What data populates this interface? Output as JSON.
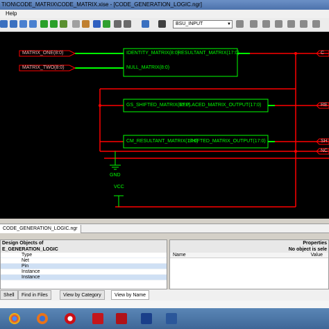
{
  "window": {
    "title": "TION\\CODE_MATRIX\\CODE_MATRIX.xise - [CODE_GENERATION_LOGIC.ngr]"
  },
  "menu": {
    "help": "Help"
  },
  "toolbar": {
    "select_value": "BSU_INPUT"
  },
  "schematic": {
    "inputs": [
      "MATRIX_ONE(8:0)",
      "MATRIX_TWO(8:0)"
    ],
    "blocks": [
      {
        "pin_left_1": "IDENTITY_MATRIX(8:0)",
        "pin_left_2": "NULL_MATRIX(8:0)",
        "pin_right": "RESULTANT_MATRIX(17:0)"
      },
      {
        "pin_left": "GS_SHIFTED_MATRIX(17:0)",
        "pin_right": "REPLACED_MATRIX_OUTPUT(17:0)"
      },
      {
        "pin_left": "CM_RESULTANT_MATRIX(17:0)",
        "pin_right": "SHIFTED_MATRIX_OUTPUT(17:0)"
      }
    ],
    "outputs": [
      "C",
      "RE",
      "SH",
      "NC"
    ],
    "gnd": "GND",
    "vcc": "VCC"
  },
  "doc_tab": "CODE_GENERATION_LOGIC.ngr",
  "design_panel": {
    "title_line1": "Design Objects of",
    "title_line2": "E_GENERATION_LOGIC",
    "rows": [
      "Type",
      "Net",
      "Pin",
      "Instance",
      "Instance"
    ]
  },
  "props_panel": {
    "title": "Properties",
    "subtitle": "No object is sele",
    "col_name": "Name",
    "col_value": "Value"
  },
  "bottom_tabs": [
    "Shell",
    "Find in Files",
    "View by Category",
    "View by Name"
  ],
  "colors": {
    "wire_red": "#ff0000",
    "bus_green": "#00ff00",
    "inst_green": "#00ff00",
    "background": "#000000"
  },
  "taskbar_icons": [
    "chrome-icon",
    "firefox-icon",
    "opera-icon",
    "acrobat-icon",
    "acrobat-icon",
    "ise-icon",
    "word-icon"
  ]
}
